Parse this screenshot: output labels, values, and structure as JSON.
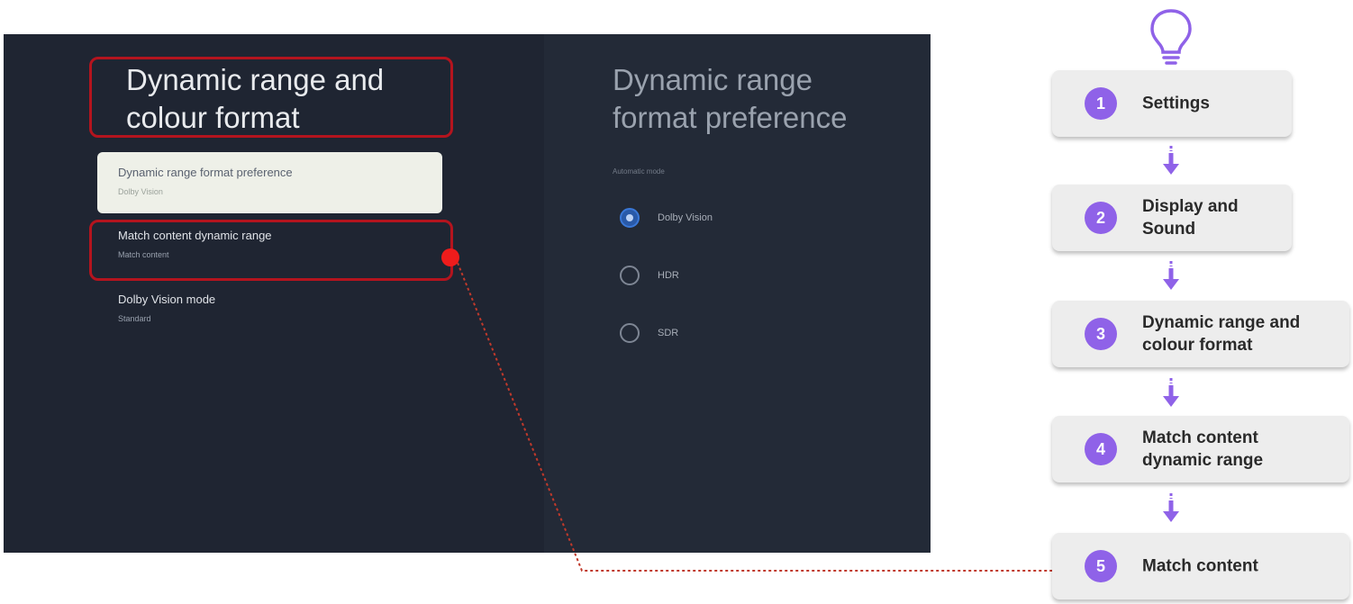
{
  "tv": {
    "page_title": "Dynamic range and colour format",
    "menu": [
      {
        "label": "Dynamic range format preference",
        "sub": "Dolby Vision"
      },
      {
        "label": "Match content dynamic range",
        "sub": "Match content"
      },
      {
        "label": "Dolby Vision mode",
        "sub": "Standard"
      }
    ],
    "panel_title": "Dynamic range format preference",
    "panel_caption": "Automatic mode",
    "options": [
      {
        "label": "Dolby Vision",
        "checked": true
      },
      {
        "label": "HDR",
        "checked": false
      },
      {
        "label": "SDR",
        "checked": false
      }
    ]
  },
  "steps": [
    {
      "num": "1",
      "label": "Settings"
    },
    {
      "num": "2",
      "label": "Display and Sound"
    },
    {
      "num": "3",
      "label": "Dynamic range and colour format"
    },
    {
      "num": "4",
      "label": "Match content dynamic range"
    },
    {
      "num": "5",
      "label": "Match content"
    }
  ],
  "colors": {
    "tv_background": "#1f2532",
    "highlight_box": "#b4141e",
    "step_badge": "#8f62e8",
    "arrow": "#8f62e8",
    "connector": "#c0392b"
  },
  "icons": {
    "top": "lightbulb-icon",
    "arrows": "arrow-down-icon"
  }
}
